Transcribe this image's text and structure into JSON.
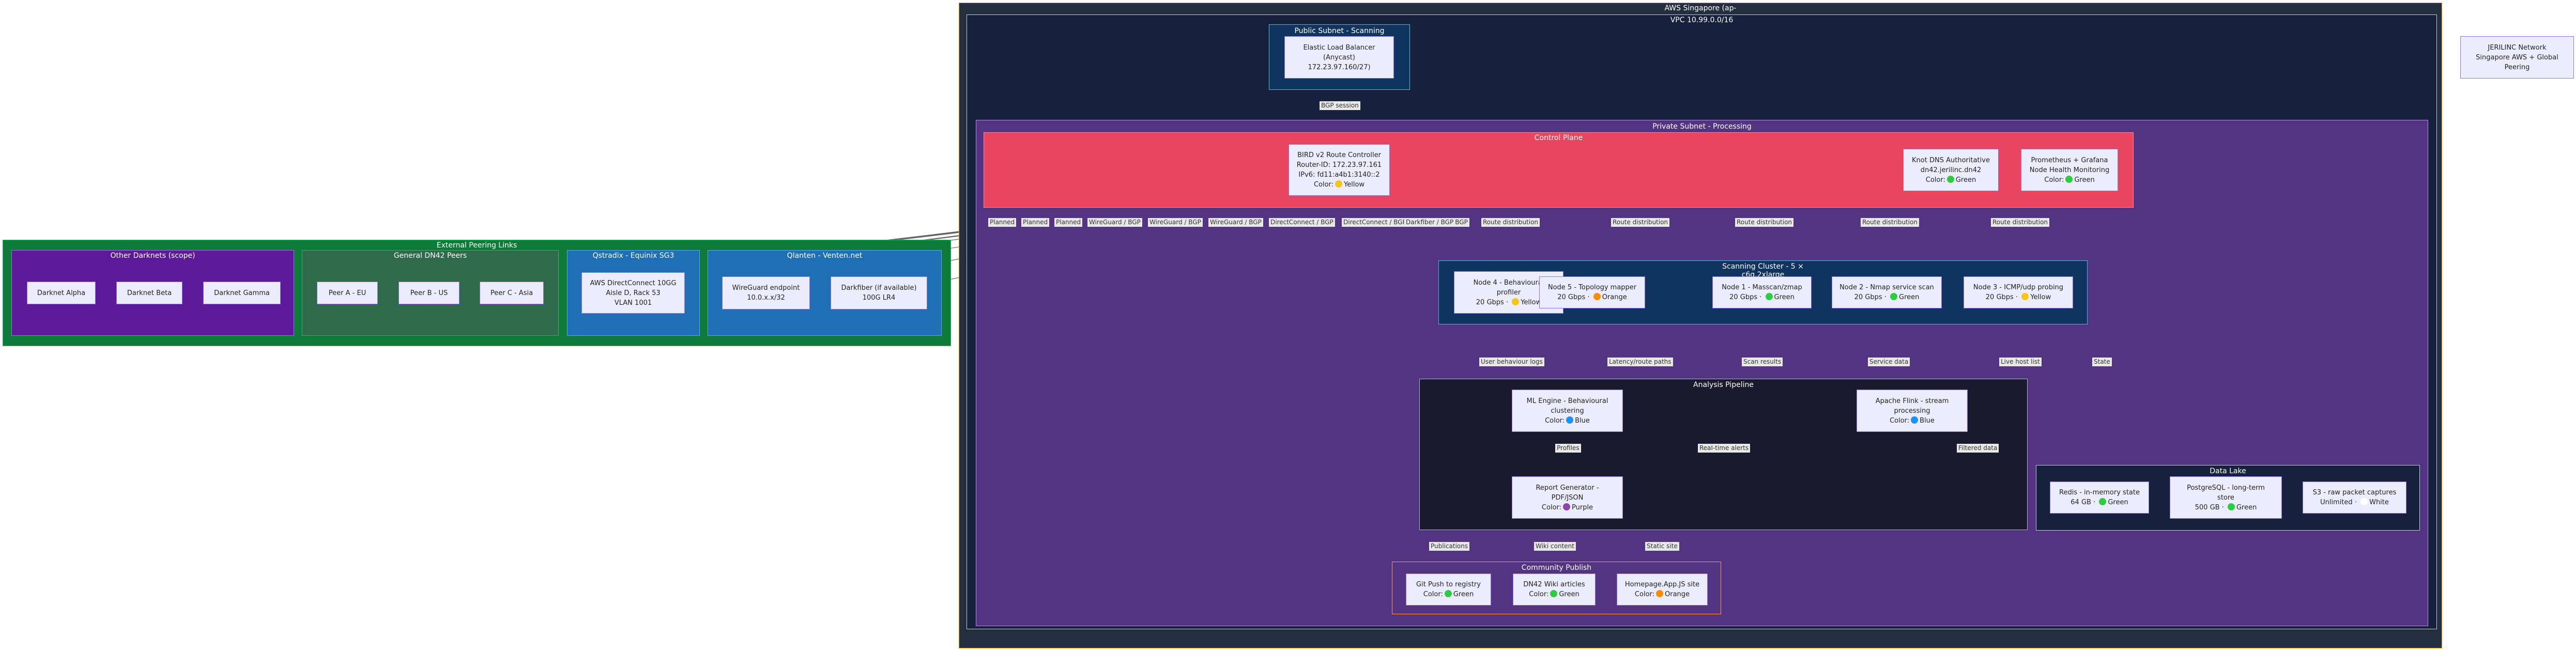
{
  "clusters": {
    "aws_region": "AWS Singapore (ap-",
    "vpc": "VPC 10.99.0.0/16",
    "public_subnet": "Public Subnet - Scanning",
    "private_subnet": "Private Subnet - Processing",
    "control_plane": "Control Plane",
    "scanning_cluster_1": "Scanning Cluster - 5 ×",
    "scanning_cluster_2": "c6g.2xlarge",
    "analysis": "Analysis Pipeline",
    "datalake": "Data Lake",
    "community": "Community Publish",
    "external": "External Peering Links",
    "darknets": "Other Darknets (scope)",
    "dn42": "General DN42 Peers",
    "equinix": "Qstradix - Equinix SG3",
    "qventen": "Qlanten - Venten.net"
  },
  "nodes": {
    "elb": [
      "Elastic Load Balancer",
      "(Anycast)",
      "172.23.97.160/27)"
    ],
    "bird": [
      "BIRD v2 Route Controller",
      "Router-ID: 172.23.97.161",
      "IPv6: fd11:a4b1:3140::2"
    ],
    "bird_color": "Yellow",
    "knot": [
      "Knot DNS Authoritative",
      "dn42.jerilinc.dn42"
    ],
    "knot_color": "Green",
    "prom": [
      "Prometheus + Grafana",
      "Node Health Monitoring"
    ],
    "prom_color": "Green",
    "node4": [
      "Node 4 - Behavioural",
      "profiler"
    ],
    "node4_rate": "20 Gbps",
    "node4_color": "Yellow",
    "node5": [
      "Node 5 - Topology mapper"
    ],
    "node5_rate": "20 Gbps",
    "node5_color": "Orange",
    "node1": [
      "Node 1 - Masscan/zmap"
    ],
    "node1_rate": "20 Gbps",
    "node1_color": "Green",
    "node2": [
      "Node 2 - Nmap service scan"
    ],
    "node2_rate": "20 Gbps",
    "node2_color": "Green",
    "node3": [
      "Node 3 - ICMP/udp probing"
    ],
    "node3_rate": "20 Gbps",
    "node3_color": "Yellow",
    "ml": [
      "ML Engine - Behavioural",
      "clustering"
    ],
    "ml_color": "Blue",
    "flink": [
      "Apache Flink - stream",
      "processing"
    ],
    "flink_color": "Blue",
    "report": [
      "Report Generator -",
      "PDF/JSON"
    ],
    "report_color": "Purple",
    "redis": [
      "Redis - in-memory state"
    ],
    "redis_size": "64 GB",
    "redis_color": "Green",
    "pg": [
      "PostgreSQL - long-term",
      "store"
    ],
    "pg_size": "500 GB",
    "pg_color": "Green",
    "s3": [
      "S3 - raw packet captures"
    ],
    "s3_size": "Unlimited",
    "s3_color": "White",
    "git": [
      "Git Push to registry"
    ],
    "git_color": "Green",
    "wiki": [
      "DN42 Wiki articles"
    ],
    "wiki_color": "Green",
    "homepage": [
      "Homepage.App.JS site"
    ],
    "homepage_color": "Orange",
    "alpha": "Darknet Alpha",
    "beta": "Darknet Beta",
    "gamma": "Darknet Gamma",
    "peer_a": "Peer A - EU",
    "peer_b": "Peer B - US",
    "peer_c": "Peer C - Asia",
    "dx": [
      "AWS DirectConnect 10GG",
      "Aisle D, Rack 53",
      "VLAN 1001"
    ],
    "wg": [
      "WireGuard endpoint",
      "10.0.x.x/32"
    ],
    "darkfiber": [
      "Darkfiber (if available)",
      "100G LR4"
    ],
    "legend": [
      "JERILINC Network",
      "Singapore AWS + Global",
      "Peering"
    ]
  },
  "color_word": "Color:",
  "edge_labels": {
    "bgp_session": "BGP session",
    "planned_1": "Planned",
    "planned_2": "Planned",
    "planned_3": "Planned",
    "wg_bgp_1": "WireGuard / BGP",
    "wg_bgp_2": "WireGuard / BGP",
    "wg_bgp_3": "WireGuard / BGP",
    "dc_bgp_1": "DirectConnect / BGP",
    "dc_bgp_2": "DirectConnect / BGP",
    "wg_bgp_4": "WireGuard / BGP",
    "df_bgp": "Darkfiber / BGP",
    "route_1": "Route distribution",
    "route_2": "Route distribution",
    "route_3": "Route distribution",
    "route_4": "Route distribution",
    "route_5": "Route distribution",
    "user_behaviour": "User behaviour logs",
    "latency": "Latency/route paths",
    "scan_results": "Scan results",
    "service_data": "Service data",
    "live_host": "Live host list",
    "state": "State",
    "profiles": "Profiles",
    "realtime": "Real-time alerts",
    "filtered": "Filtered data",
    "publications": "Publications",
    "wiki_content": "Wiki content",
    "static_site": "Static site"
  },
  "colors": {
    "region": "#232f3e",
    "vpc": "#16213e",
    "public": "#0f3460",
    "private": "#533483",
    "control": "#e94560",
    "scanning": "#0f3460",
    "analysis": "#1a1a2e",
    "datalake": "#16213e",
    "external": "#0f7b3a",
    "darknets": "#5c1a9b",
    "dn42": "#2d6b4a",
    "qblue": "#1e6fb5",
    "yellow": "#f5c518",
    "orange": "#ff8c00",
    "green": "#2ecc40",
    "blue": "#1e90ff",
    "purple": "#8e44ad",
    "white": "#ffffff"
  }
}
